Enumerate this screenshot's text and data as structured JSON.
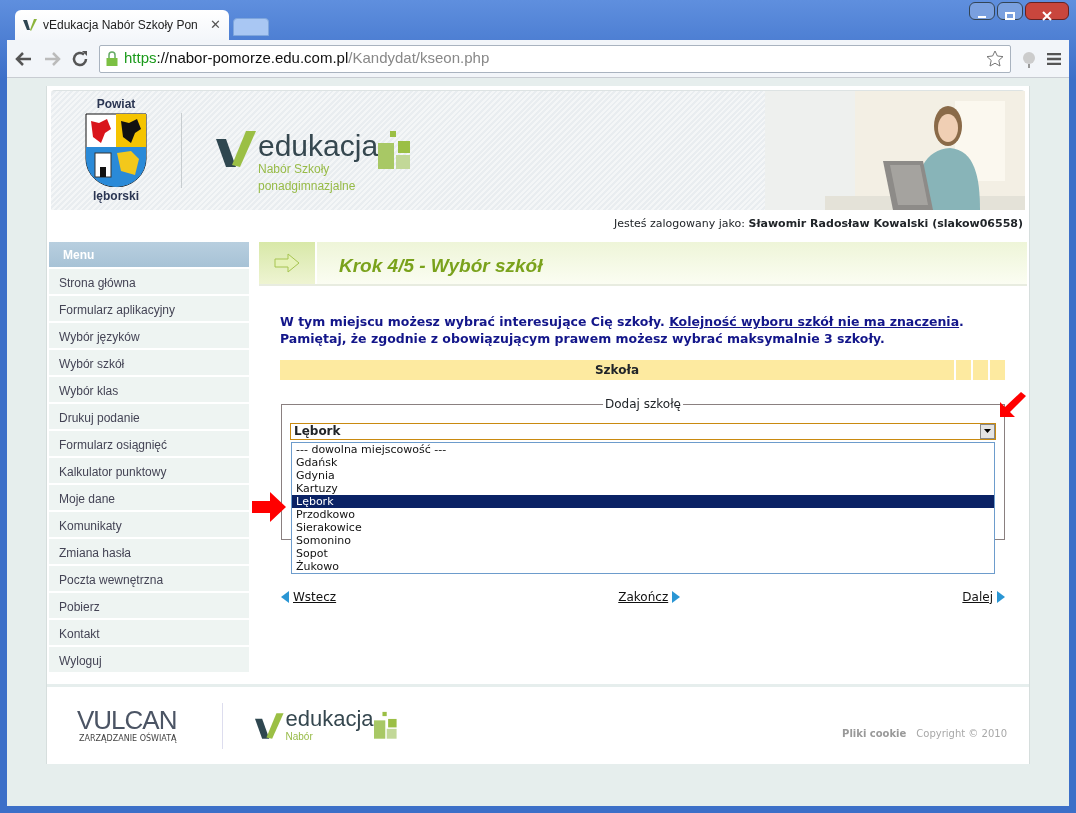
{
  "browser": {
    "tab_title": "vEdukacja Nabór Szkoły Pon",
    "tab_close": "✕",
    "url_scheme": "https",
    "url_host": "://nabor-pomorze.edu.com.pl",
    "url_path": "/Kandydat/kseon.php"
  },
  "header": {
    "coat_top": "Powiat",
    "coat_bottom": "lęborski",
    "logo_word": "edukacja",
    "logo_sub": [
      "Nabór Szkoły",
      "ponadgimnazjalne"
    ],
    "photo": {
      "kind": "picture"
    }
  },
  "user": {
    "label": "Jesteś zalogowany jako:",
    "name": "Sławomir Radosław Kowalski (slakow06558)"
  },
  "menu": {
    "title": "Menu",
    "items": [
      "Strona główna",
      "Formularz aplikacyjny",
      "Wybór języków",
      "Wybór szkół",
      "Wybór klas",
      "Drukuj podanie",
      "Formularz osiągnięć",
      "Kalkulator punktowy",
      "Moje dane",
      "Komunikaty",
      "Zmiana hasła",
      "Poczta wewnętrzna",
      "Pobierz",
      "Kontakt",
      "Wyloguj"
    ]
  },
  "step_title": "Krok 4/5 - Wybór szkół",
  "intro": {
    "before": "W tym miejscu możesz wybrać interesujące Cię szkoły.",
    "link": "Kolejność wyboru szkół nie ma znaczenia",
    "after": ".",
    "line2": "Pamiętaj, że zgodnie z obowiązującym prawem możesz wybrać maksymalnie 3 szkoły."
  },
  "table": {
    "columns": [
      "Szkoła"
    ]
  },
  "add_school": {
    "legend": "Dodaj szkołę",
    "select_value": "Lębork",
    "expanded": true,
    "options": [
      {
        "label": "--- dowolna miejscowość ---",
        "selected": false
      },
      {
        "label": "Gdańsk",
        "selected": false
      },
      {
        "label": "Gdynia",
        "selected": false
      },
      {
        "label": "Kartuzy",
        "selected": false
      },
      {
        "label": "Lębork",
        "selected": true
      },
      {
        "label": "Przodkowo",
        "selected": false
      },
      {
        "label": "Sierakowice",
        "selected": false
      },
      {
        "label": "Somonino",
        "selected": false
      },
      {
        "label": "Sopot",
        "selected": false
      },
      {
        "label": "Żukowo",
        "selected": false
      }
    ]
  },
  "nav_links": [
    "Wstecz",
    "Zakończ",
    "Dalej"
  ],
  "footer": {
    "vulcan": "VULCAN",
    "vulcan_sub": "ZARZĄDZANIE OŚWIATĄ",
    "logo_word": "edukacja",
    "logo_sub": "Nabór",
    "cookie": "Pliki cookie",
    "copyright": "Copyright © 2010"
  }
}
